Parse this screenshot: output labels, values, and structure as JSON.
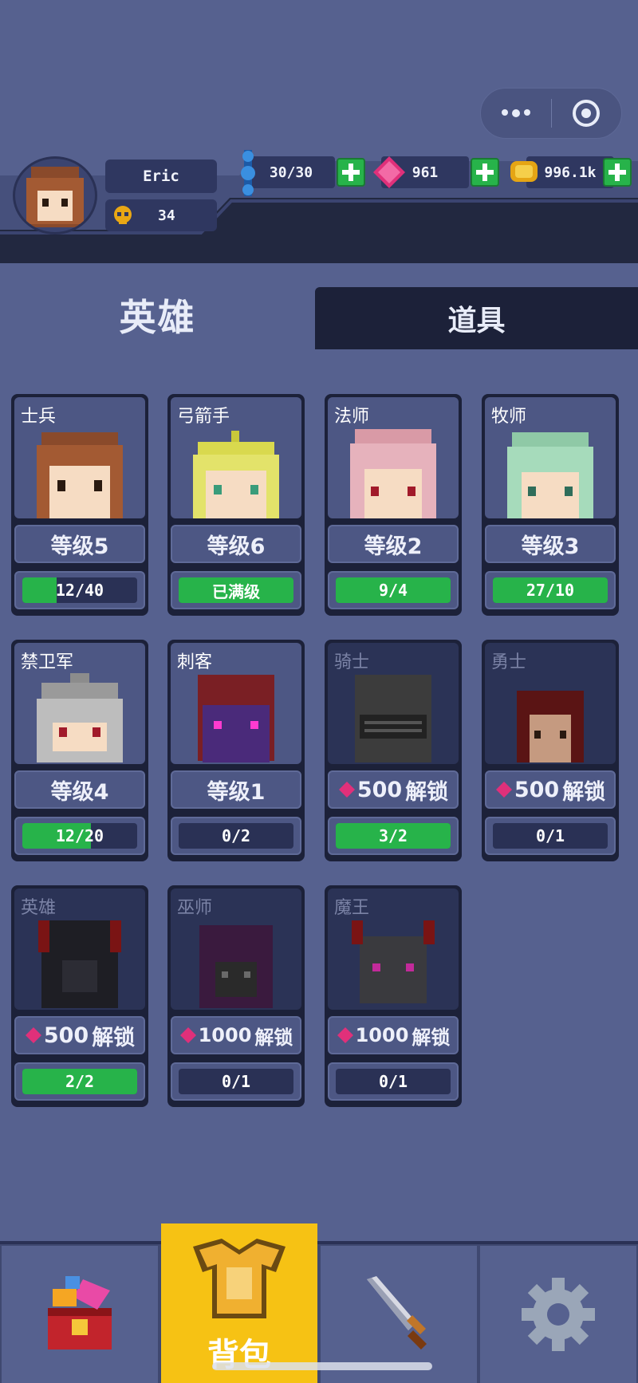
{
  "player": {
    "name": "Eric",
    "level": "34"
  },
  "resources": {
    "energy": "30/30",
    "gems": "961",
    "gold": "996.1k"
  },
  "tabs": {
    "heroes": "英雄",
    "items": "道具"
  },
  "heroes": [
    {
      "name": "士兵",
      "level": "等级5",
      "progress": "12/40",
      "fill": 0.3,
      "locked": false
    },
    {
      "name": "弓箭手",
      "level": "等级6",
      "progress": "已满级",
      "fill": 1.0,
      "locked": false
    },
    {
      "name": "法师",
      "level": "等级2",
      "progress": "9/4",
      "fill": 1.0,
      "locked": false
    },
    {
      "name": "牧师",
      "level": "等级3",
      "progress": "27/10",
      "fill": 1.0,
      "locked": false
    },
    {
      "name": "禁卫军",
      "level": "等级4",
      "progress": "12/20",
      "fill": 0.6,
      "locked": false
    },
    {
      "name": "刺客",
      "level": "等级1",
      "progress": "0/2",
      "fill": 0.0,
      "locked": false
    },
    {
      "name": "骑士",
      "cost": "500",
      "unlock": "解锁",
      "progress": "3/2",
      "fill": 1.0,
      "locked": true
    },
    {
      "name": "勇士",
      "cost": "500",
      "unlock": "解锁",
      "progress": "0/1",
      "fill": 0.0,
      "locked": true
    },
    {
      "name": "英雄",
      "cost": "500",
      "unlock": "解锁",
      "progress": "2/2",
      "fill": 1.0,
      "locked": true
    },
    {
      "name": "巫师",
      "cost": "1000",
      "unlock": "解锁",
      "progress": "0/1",
      "fill": 0.0,
      "locked": true
    },
    {
      "name": "魔王",
      "cost": "1000",
      "unlock": "解锁",
      "progress": "0/1",
      "fill": 0.0,
      "locked": true
    }
  ],
  "nav": {
    "items": [
      {
        "icon": "treasure-chest-icon"
      },
      {
        "icon": "armor-icon",
        "label": "背包",
        "active": true
      },
      {
        "icon": "sword-icon"
      },
      {
        "icon": "gear-icon"
      }
    ]
  },
  "colors": {
    "background": "#56618f",
    "card": "#1c2139",
    "progress_green": "#27b34a",
    "active_nav": "#f6c214",
    "gem": "#e0307a"
  }
}
